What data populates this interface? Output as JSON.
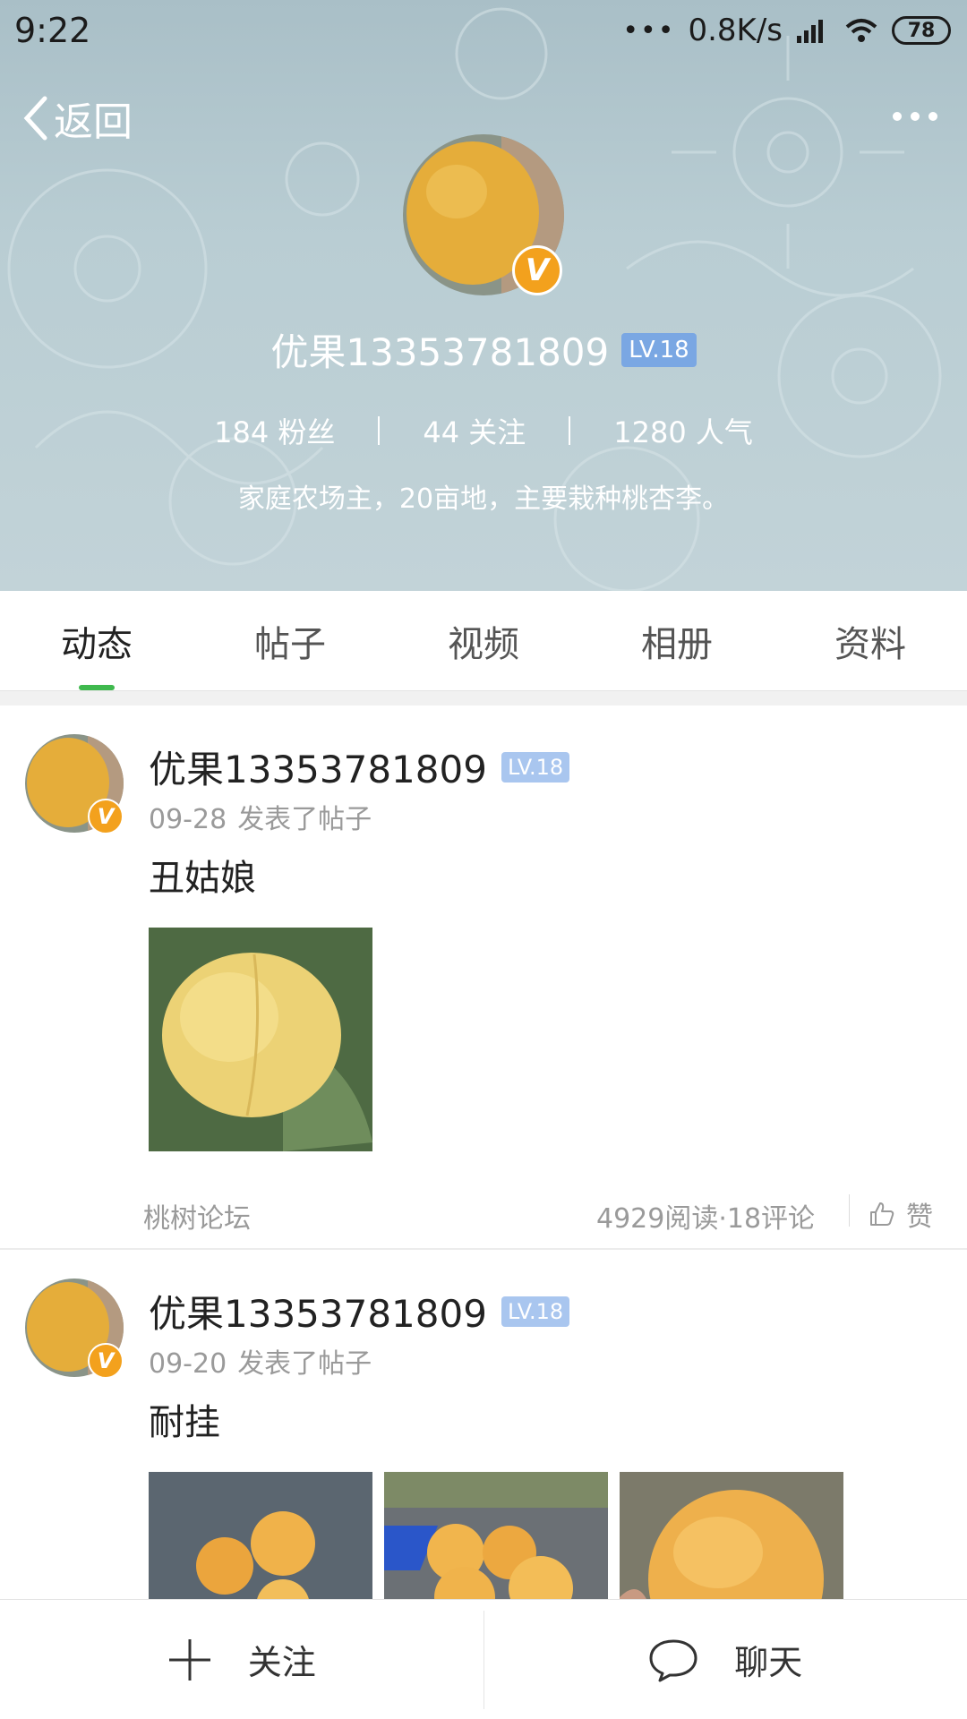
{
  "status_bar": {
    "time": "9:22",
    "dots": "•••",
    "network_speed": "0.8K/s",
    "battery": "78"
  },
  "header": {
    "back_label": "返回",
    "user_name": "优果13353781809",
    "level": "LV.18",
    "verified_badge": "V",
    "stats": {
      "fans": "184 粉丝",
      "following": "44 关注",
      "popularity": "1280 人气"
    },
    "bio": "家庭农场主，20亩地，主要栽种桃杏李。"
  },
  "tabs": [
    {
      "label": "动态",
      "active": true
    },
    {
      "label": "帖子",
      "active": false
    },
    {
      "label": "视频",
      "active": false
    },
    {
      "label": "相册",
      "active": false
    },
    {
      "label": "资料",
      "active": false
    }
  ],
  "posts": [
    {
      "user_name": "优果13353781809",
      "level": "LV.18",
      "date": "09-28",
      "action": "发表了帖子",
      "title": "丑姑娘",
      "forum": "桃树论坛",
      "stats": "4929阅读·18评论",
      "like_label": "赞"
    },
    {
      "user_name": "优果13353781809",
      "level": "LV.18",
      "date": "09-20",
      "action": "发表了帖子",
      "title": "耐挂"
    }
  ],
  "bottom_bar": {
    "follow_label": "关注",
    "chat_label": "聊天"
  },
  "colors": {
    "accent_green": "#3fb94e",
    "level_badge": "#7aa7e3",
    "verified_orange": "#f3a11d",
    "header_bg": "#b9cdd3"
  },
  "icons": [
    "back-chevron-icon",
    "more-icon",
    "signal-icon",
    "wifi-icon",
    "battery-icon",
    "thumbs-up-icon",
    "plus-icon",
    "chat-bubble-icon"
  ]
}
